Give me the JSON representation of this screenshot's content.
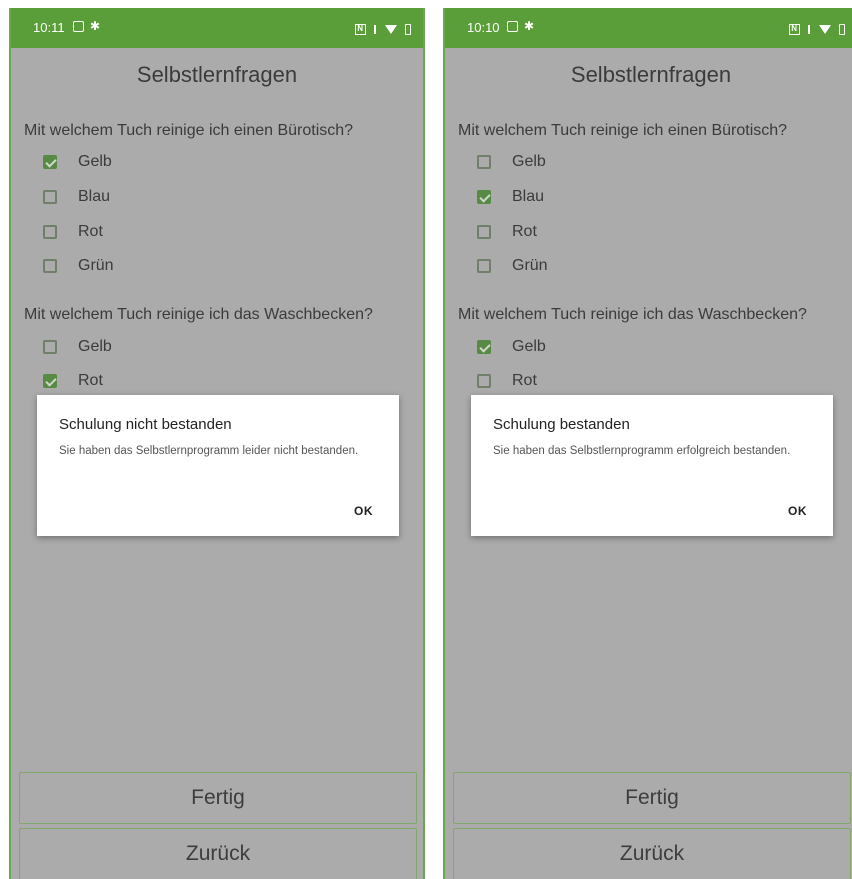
{
  "screens": [
    {
      "status_time": "10:11",
      "app_title": "Selbstlernfragen",
      "q1": {
        "text": "Mit welchem Tuch reinige ich einen Bürotisch?",
        "options": [
          {
            "label": "Gelb",
            "checked": true
          },
          {
            "label": "Blau",
            "checked": false
          },
          {
            "label": "Rot",
            "checked": false
          },
          {
            "label": "Grün",
            "checked": false
          }
        ]
      },
      "q2": {
        "text": "Mit welchem Tuch reinige ich das Waschbecken?",
        "options": [
          {
            "label": "Gelb",
            "checked": false
          },
          {
            "label": "Rot",
            "checked": true
          }
        ]
      },
      "dialog": {
        "title": "Schulung nicht bestanden",
        "message": "Sie haben das Selbstlernprogramm leider nicht bestanden.",
        "ok": "OK"
      },
      "buttons": {
        "done": "Fertig",
        "back": "Zurück"
      }
    },
    {
      "status_time": "10:10",
      "app_title": "Selbstlernfragen",
      "q1": {
        "text": "Mit welchem Tuch reinige ich einen Bürotisch?",
        "options": [
          {
            "label": "Gelb",
            "checked": false
          },
          {
            "label": "Blau",
            "checked": true
          },
          {
            "label": "Rot",
            "checked": false
          },
          {
            "label": "Grün",
            "checked": false
          }
        ]
      },
      "q2": {
        "text": "Mit welchem Tuch reinige ich das Waschbecken?",
        "options": [
          {
            "label": "Gelb",
            "checked": true
          },
          {
            "label": "Rot",
            "checked": false
          }
        ]
      },
      "dialog": {
        "title": "Schulung bestanden",
        "message": "Sie haben das Selbstlernprogramm erfolgreich bestanden.",
        "ok": "OK"
      },
      "buttons": {
        "done": "Fertig",
        "back": "Zurück"
      }
    }
  ],
  "icons": {
    "status_left": [
      "calendar-icon",
      "gear-icon"
    ],
    "status_right": [
      "nfc-icon",
      "alert-icon",
      "wifi-icon",
      "battery-icon"
    ]
  },
  "colors": {
    "status_bar": "#5a9e3a",
    "checkbox_checked": "#578a45",
    "scrim_background": "#ababab",
    "dialog_background": "#ffffff"
  }
}
